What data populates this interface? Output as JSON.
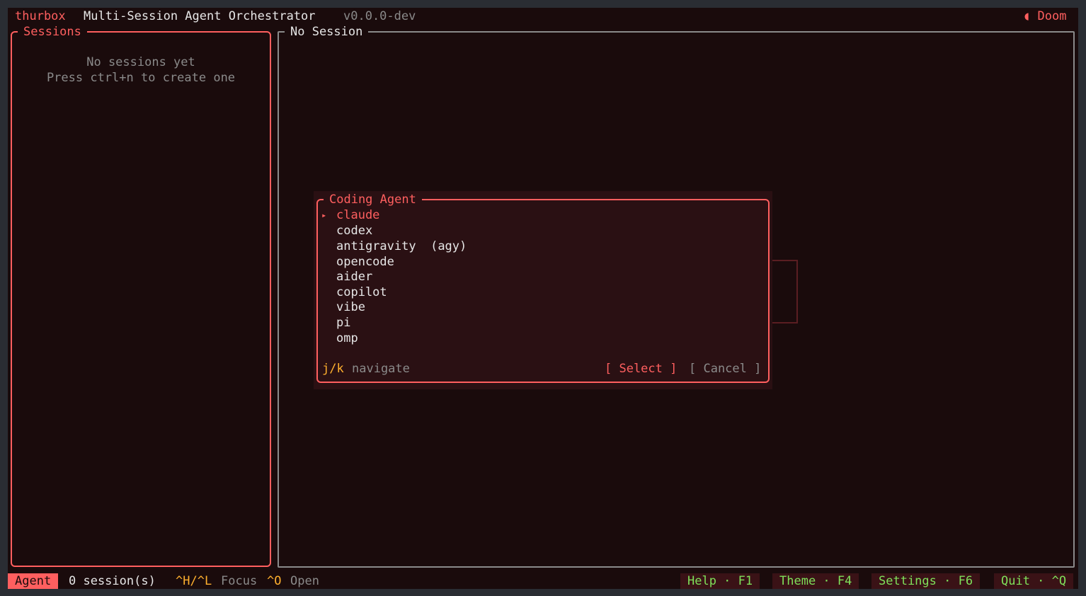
{
  "header": {
    "app_name": "thurbox",
    "subtitle": "Multi-Session Agent Orchestrator",
    "version": "v0.0.0-dev",
    "theme_icon": "◖",
    "theme_name": "Doom"
  },
  "sessions": {
    "title": "Sessions",
    "empty_line1": "No sessions yet",
    "empty_line2": "Press ctrl+n to create one"
  },
  "main": {
    "title": "No Session"
  },
  "modal": {
    "title": "Coding Agent",
    "selected_marker": "▸",
    "agents": [
      {
        "label": "claude",
        "alias": ""
      },
      {
        "label": "codex",
        "alias": ""
      },
      {
        "label": "antigravity",
        "alias": "(agy)"
      },
      {
        "label": "opencode",
        "alias": ""
      },
      {
        "label": "aider",
        "alias": ""
      },
      {
        "label": "copilot",
        "alias": ""
      },
      {
        "label": "vibe",
        "alias": ""
      },
      {
        "label": "pi",
        "alias": ""
      },
      {
        "label": "omp",
        "alias": ""
      }
    ],
    "hint_key": "j/k",
    "hint_text": "navigate",
    "select_label": "[ Select ]",
    "cancel_label": "[ Cancel ]"
  },
  "status": {
    "mode": "Agent",
    "session_count": "0 session(s)",
    "focus_key": "^H/^L",
    "focus_label": "Focus",
    "open_key": "^O",
    "open_label": "Open",
    "shortcuts": [
      {
        "label": "Help · F1"
      },
      {
        "label": "Theme · F4"
      },
      {
        "label": "Settings · F6"
      },
      {
        "label": "Quit · ^Q"
      }
    ]
  },
  "colors": {
    "accent": "#ff5f5f",
    "background": "#1a0b0c",
    "key_hint": "#ffb02e",
    "shortcut_text": "#7fe05a"
  }
}
